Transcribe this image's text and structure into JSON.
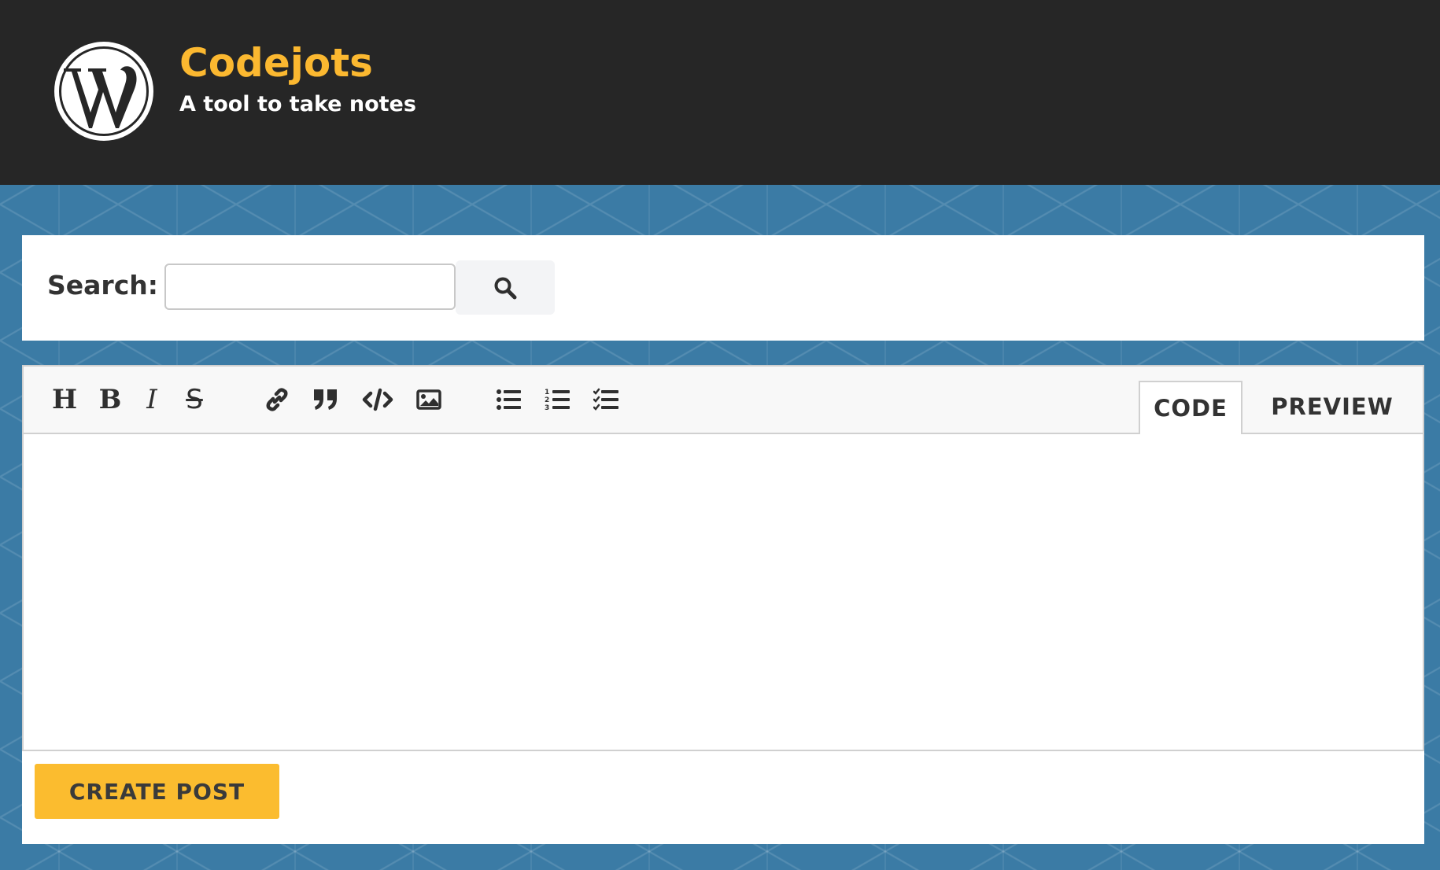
{
  "header": {
    "site_title": "Codejots",
    "tagline": "A tool to take notes",
    "logo_icon": "wordpress-logo-icon",
    "title_color": "#fbb830",
    "background_color": "#262626"
  },
  "search": {
    "label": "Search:",
    "value": "",
    "placeholder": "",
    "button_icon": "search-icon"
  },
  "editor": {
    "toolbar": [
      {
        "name": "heading",
        "icon": "heading-icon",
        "glyph": "H"
      },
      {
        "name": "bold",
        "icon": "bold-icon",
        "glyph": "B"
      },
      {
        "name": "italic",
        "icon": "italic-icon",
        "glyph": "I"
      },
      {
        "name": "strikethrough",
        "icon": "strikethrough-icon",
        "glyph": "S"
      },
      {
        "name": "link",
        "icon": "link-icon"
      },
      {
        "name": "quote",
        "icon": "quote-icon"
      },
      {
        "name": "code",
        "icon": "code-icon"
      },
      {
        "name": "image",
        "icon": "image-icon"
      },
      {
        "name": "unordered-list",
        "icon": "unordered-list-icon"
      },
      {
        "name": "ordered-list",
        "icon": "ordered-list-icon"
      },
      {
        "name": "task-list",
        "icon": "task-list-icon"
      }
    ],
    "tabs": {
      "code": "CODE",
      "preview": "PREVIEW",
      "active": "CODE"
    },
    "content": ""
  },
  "actions": {
    "create_post": "CREATE POST",
    "button_color": "#fbbc2f"
  },
  "page": {
    "background_color": "#3b7ba5"
  }
}
